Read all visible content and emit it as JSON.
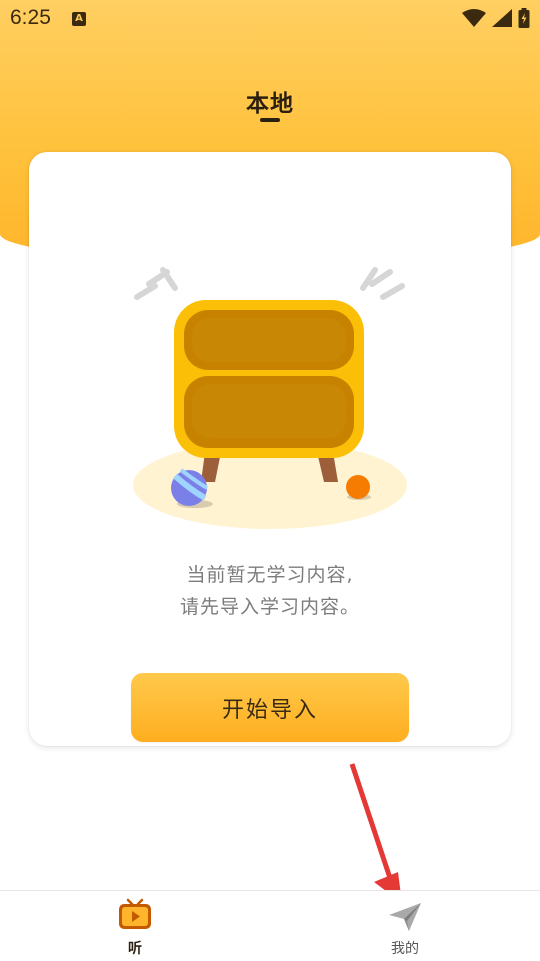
{
  "status_bar": {
    "time": "6:25",
    "notification_icon": "text-a-icon",
    "icons": [
      "wifi-icon",
      "signal-icon",
      "battery-charging-icon"
    ]
  },
  "header": {
    "title": "本地"
  },
  "empty_state": {
    "illustration": "empty-cabinet-illustration",
    "line1": "当前暂无学习内容,",
    "line2": "请先导入学习内容。",
    "button_label": "开始导入"
  },
  "bottom_nav": {
    "items": [
      {
        "label": "听",
        "icon": "tv-play-icon",
        "active": true
      },
      {
        "label": "我的",
        "icon": "paper-plane-icon",
        "active": false
      }
    ]
  },
  "colors": {
    "accent": "#ffc23d",
    "cabinet": "#fcbf07",
    "cabinet_inner": "#c78300",
    "annotation": "#e53935"
  }
}
